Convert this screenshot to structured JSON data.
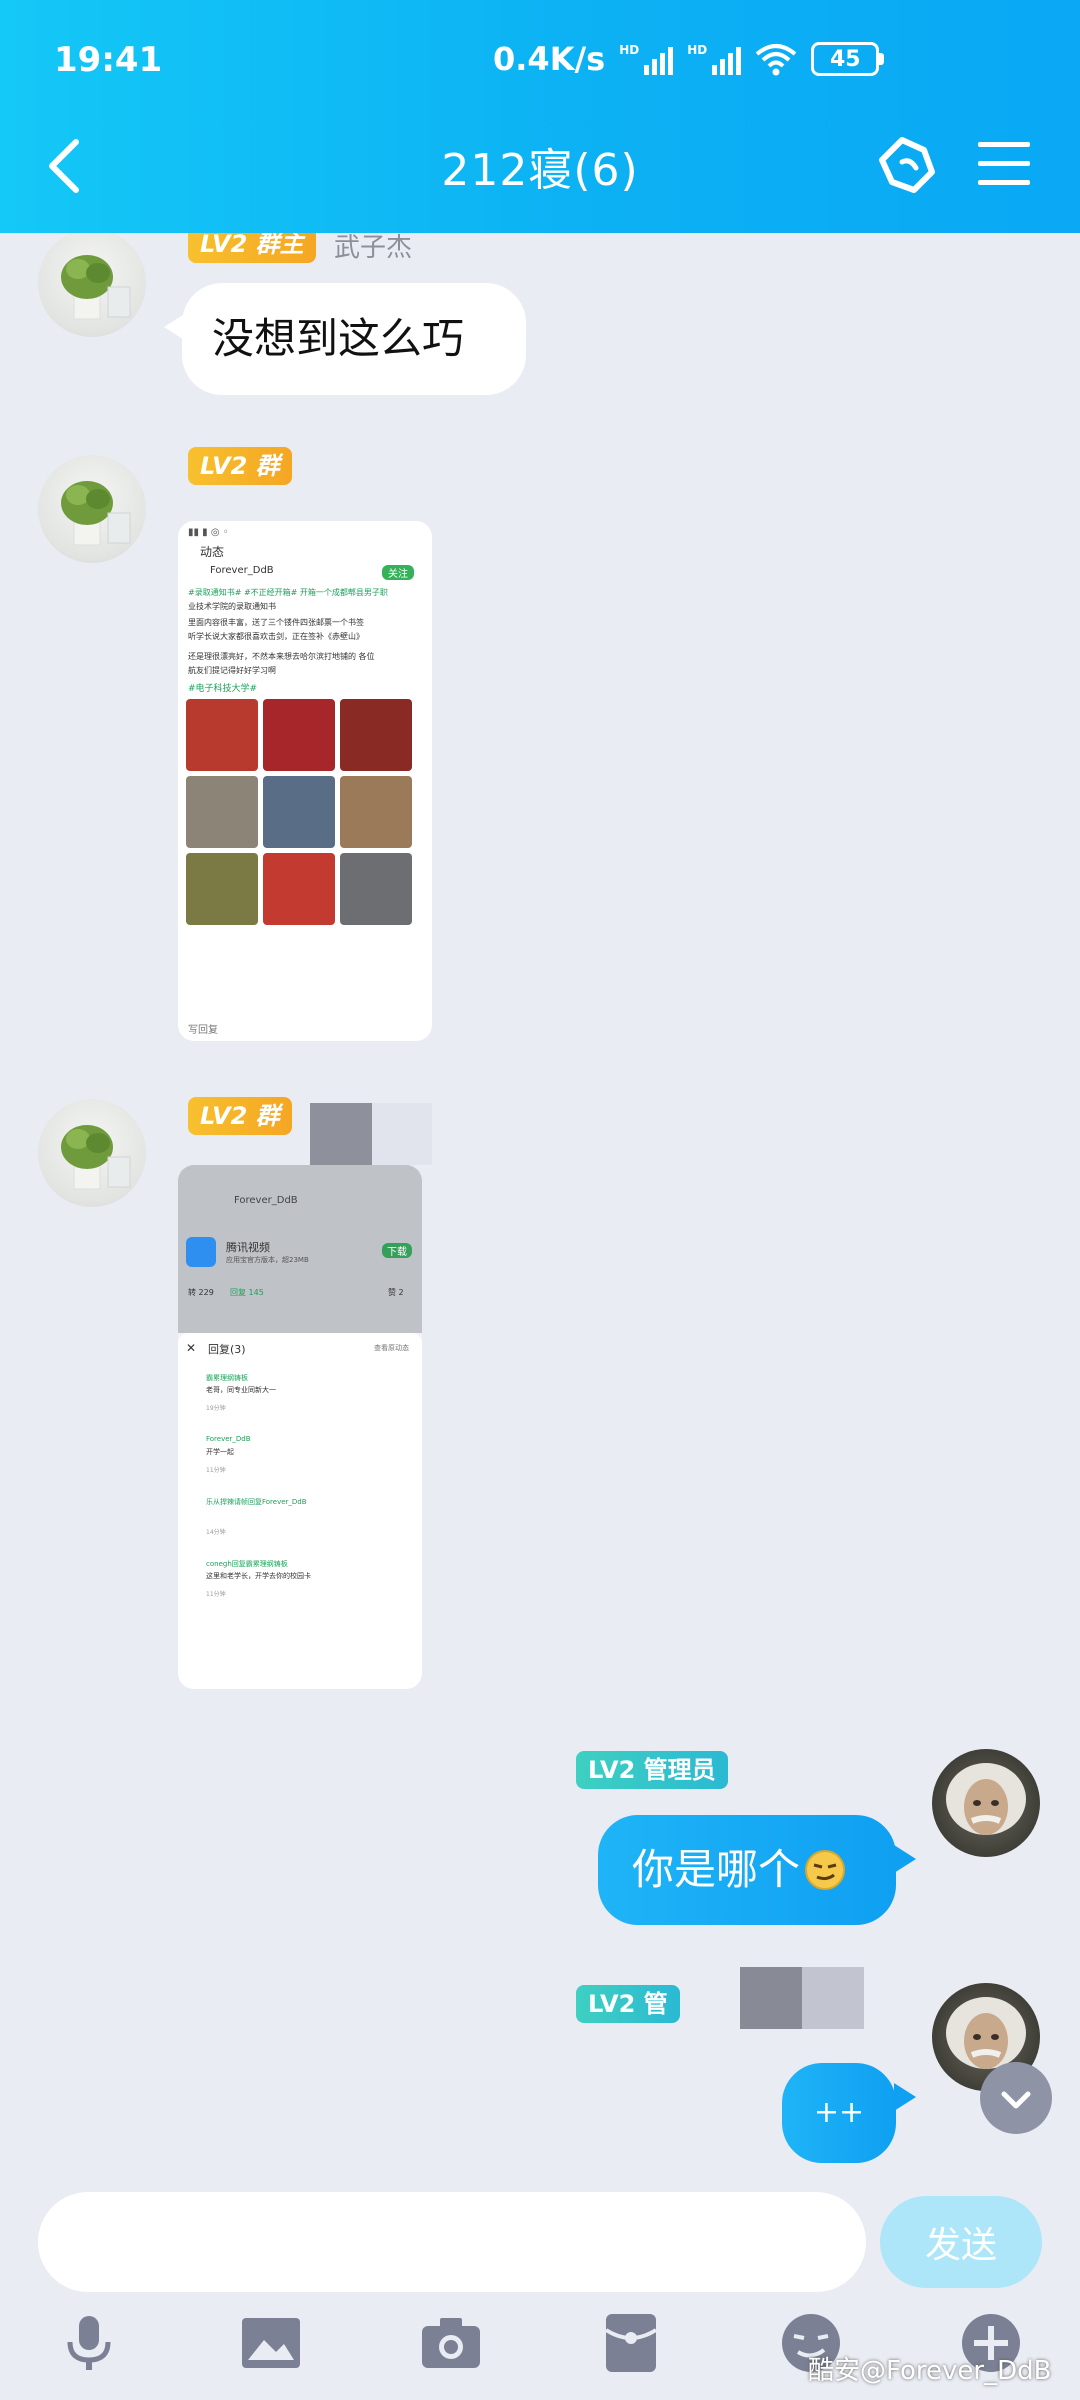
{
  "status_bar": {
    "time": "19:41",
    "network_speed": "0.4K/s",
    "signal_label": "HD",
    "battery": "45"
  },
  "header": {
    "title": "212寝(6)"
  },
  "messages": [
    {
      "sender_badge": "LV2 群主",
      "sender_name": "武子杰",
      "text": "没想到这么巧"
    },
    {
      "sender_badge": "LV2 群"
    },
    {
      "sender_badge": "LV2 群"
    },
    {
      "sender_badge": "LV2 管理员",
      "text": "你是哪个"
    },
    {
      "sender_badge": "LV2 管",
      "text": "++"
    }
  ],
  "shot1": {
    "nav_title": "动态",
    "user": "Forever_DdB",
    "follow": "关注",
    "line1": "#录取通知书# #不正经开箱# 开箱一个成都郫县男子职",
    "line2": "业技术学院的录取通知书",
    "line3": "里面内容很丰富，送了三个镂件四张邮票一个书签",
    "line4": "听学长说大家都很喜欢击剑，正在签补《赤壁山》",
    "line5": "还是理很漂亮好，不然本来想去哈尔滨打地铺的 各位",
    "line6": "航友们提记得好好学习啊",
    "tag": "#电子科技大学#",
    "footer_left": "写回复"
  },
  "shot2": {
    "user": "Forever_DdB",
    "app_name": "腾讯视频",
    "app_sub": "应用宝官方版本，超23MB",
    "download": "下载",
    "tab_a": "转 229",
    "tab_b": "回复 145",
    "tab_c": "赞 2",
    "sheet_title": "回复(3)",
    "sheet_action": "查看原动态",
    "r1_name": "霸累理纲铸板",
    "r1_text": "老哥，同专业同新大一",
    "r1_time": "19分钟",
    "r2_name": "Forever_DdB",
    "r2_text": "开学一起",
    "r2_time": "11分钟",
    "r3_name": "乐从捍辣请帧回复Forever_DdB",
    "r3_time": "14分钟",
    "r4_name": "conegh回复霸累理纲铸板",
    "r4_text": "这里和老学长，开学去你的校园卡",
    "r4_time": "11分钟"
  },
  "input": {
    "send_label": "发送"
  },
  "toolbar": [
    "microphone-icon",
    "image-icon",
    "camera-icon",
    "red-packet-icon",
    "emoji-icon",
    "plus-icon"
  ],
  "watermark": "酷安@Forever_DdB",
  "colors": {
    "header": "#0cb1f3",
    "out_bubble": "#1fb4f7",
    "badge_gold": "#f5a623",
    "badge_teal": "#2bb9d3"
  }
}
